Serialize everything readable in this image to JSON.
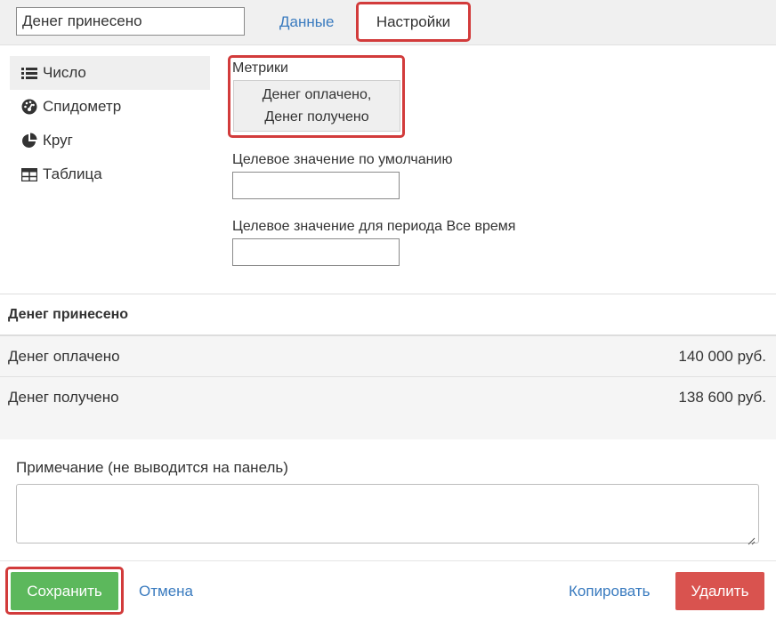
{
  "header": {
    "name_value": "Денег принесено",
    "tab_data": "Данные",
    "tab_settings": "Настройки"
  },
  "sidebar": {
    "items": [
      {
        "label": "Число",
        "icon": "list-icon",
        "active": true
      },
      {
        "label": "Спидометр",
        "icon": "speedometer-icon",
        "active": false
      },
      {
        "label": "Круг",
        "icon": "pie-chart-icon",
        "active": false
      },
      {
        "label": "Таблица",
        "icon": "table-icon",
        "active": false
      }
    ]
  },
  "settings": {
    "metrics_label": "Метрики",
    "metrics_line1": "Денег оплачено,",
    "metrics_line2": "Денег получено",
    "default_target_label": "Целевое значение по умолчанию",
    "period_target_label": "Целевое значение для периода Все время"
  },
  "table": {
    "title": "Денег принесено",
    "rows": [
      {
        "name": "Денег оплачено",
        "value": "140 000 руб."
      },
      {
        "name": "Денег получено",
        "value": "138 600 руб."
      }
    ]
  },
  "note": {
    "label": "Примечание (не выводится на панель)"
  },
  "footer": {
    "save": "Сохранить",
    "cancel": "Отмена",
    "copy": "Копировать",
    "delete": "Удалить"
  },
  "colors": {
    "accent_link": "#3a7bbf",
    "highlight_outline": "#d23b3b",
    "save_green": "#5cb85c",
    "delete_red": "#d9534f"
  }
}
